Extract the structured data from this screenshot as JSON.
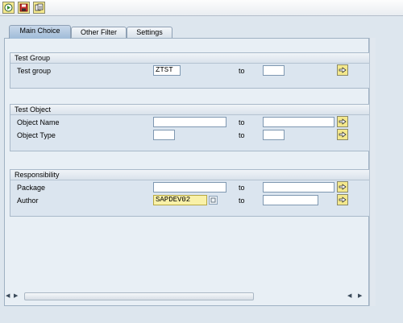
{
  "toolbar": {
    "buttons": [
      {
        "icon": "execute-icon"
      },
      {
        "icon": "save-icon"
      },
      {
        "icon": "get-variant-icon"
      }
    ]
  },
  "tabs": [
    {
      "label": "Main Choice",
      "active": true
    },
    {
      "label": "Other Filter",
      "active": false
    },
    {
      "label": "Settings",
      "active": false
    }
  ],
  "groups": {
    "test_group": {
      "title": "Test Group",
      "rows": [
        {
          "label": "Test group",
          "from": "ZTST",
          "to_label": "to",
          "to": ""
        }
      ]
    },
    "test_object": {
      "title": "Test Object",
      "rows": [
        {
          "label": "Object Name",
          "from": "",
          "to_label": "to",
          "to": ""
        },
        {
          "label": "Object Type",
          "from": "",
          "to_label": "to",
          "to": ""
        }
      ]
    },
    "responsibility": {
      "title": "Responsibility",
      "rows": [
        {
          "label": "Package",
          "from": "",
          "to_label": "to",
          "to": ""
        },
        {
          "label": "Author",
          "from": "SAPDEV02",
          "to_label": "to",
          "to": ""
        }
      ]
    }
  },
  "colors": {
    "background": "#dde6ee",
    "active_tab": "#9fbbd8",
    "highlight_field": "#f9f1a8",
    "button_yellow": "#f4e88c"
  }
}
